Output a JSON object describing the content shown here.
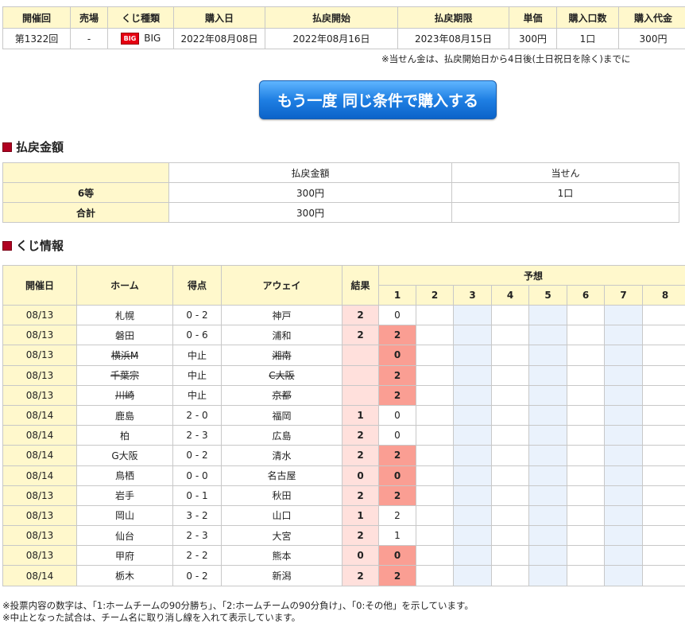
{
  "purchase": {
    "headers": [
      "開催回",
      "売場",
      "くじ種類",
      "購入日",
      "払戻開始",
      "払戻期限",
      "単価",
      "購入口数",
      "購入代金"
    ],
    "row": {
      "round": "第1322回",
      "shop": "-",
      "logo_text": "BIG",
      "kind": "BIG",
      "purchase_date": "2022年08月08日",
      "refund_start": "2022年08月16日",
      "refund_deadline": "2023年08月15日",
      "price": "300円",
      "units": "1口",
      "amount": "300円"
    }
  },
  "top_note": "※当せん金は、払戻開始日から4日後(土日祝日を除く)までに",
  "rebuy_button": "もう一度 同じ条件で購入する",
  "payout_section": {
    "title": "払戻金額",
    "headers": [
      "払戻金額",
      "当せん"
    ],
    "rows": [
      {
        "label": "6等",
        "amount": "300円",
        "count": "1口"
      },
      {
        "label": "合計",
        "amount": "300円",
        "count": ""
      }
    ]
  },
  "info_section": {
    "title": "くじ情報",
    "headers": {
      "date": "開催日",
      "home": "ホーム",
      "score": "得点",
      "away": "アウェイ",
      "result": "結果",
      "prediction": "予想",
      "cols": [
        "1",
        "2",
        "3",
        "4",
        "5",
        "6",
        "7",
        "8"
      ]
    },
    "rows": [
      {
        "date": "08/13",
        "home": "札幌",
        "score": "0 - 2",
        "away": "神戸",
        "result": "2",
        "pred": "0",
        "hit": false,
        "cancelled": false
      },
      {
        "date": "08/13",
        "home": "磐田",
        "score": "0 - 6",
        "away": "浦和",
        "result": "2",
        "pred": "2",
        "hit": true,
        "cancelled": false
      },
      {
        "date": "08/13",
        "home": "横浜M",
        "score": "中止",
        "away": "湘南",
        "result": "",
        "pred": "0",
        "hit": true,
        "cancelled": true
      },
      {
        "date": "08/13",
        "home": "千葉宗",
        "score": "中止",
        "away": "C大阪",
        "result": "",
        "pred": "2",
        "hit": true,
        "cancelled": true
      },
      {
        "date": "08/13",
        "home": "川崎",
        "score": "中止",
        "away": "京都",
        "result": "",
        "pred": "2",
        "hit": true,
        "cancelled": true
      },
      {
        "date": "08/14",
        "home": "鹿島",
        "score": "2 - 0",
        "away": "福岡",
        "result": "1",
        "pred": "0",
        "hit": false,
        "cancelled": false
      },
      {
        "date": "08/14",
        "home": "柏",
        "score": "2 - 3",
        "away": "広島",
        "result": "2",
        "pred": "0",
        "hit": false,
        "cancelled": false
      },
      {
        "date": "08/14",
        "home": "G大阪",
        "score": "0 - 2",
        "away": "清水",
        "result": "2",
        "pred": "2",
        "hit": true,
        "cancelled": false
      },
      {
        "date": "08/14",
        "home": "鳥栖",
        "score": "0 - 0",
        "away": "名古屋",
        "result": "0",
        "pred": "0",
        "hit": true,
        "cancelled": false
      },
      {
        "date": "08/13",
        "home": "岩手",
        "score": "0 - 1",
        "away": "秋田",
        "result": "2",
        "pred": "2",
        "hit": true,
        "cancelled": false
      },
      {
        "date": "08/13",
        "home": "岡山",
        "score": "3 - 2",
        "away": "山口",
        "result": "1",
        "pred": "2",
        "hit": false,
        "cancelled": false
      },
      {
        "date": "08/13",
        "home": "仙台",
        "score": "2 - 3",
        "away": "大宮",
        "result": "2",
        "pred": "1",
        "hit": false,
        "cancelled": false
      },
      {
        "date": "08/13",
        "home": "甲府",
        "score": "2 - 2",
        "away": "熊本",
        "result": "0",
        "pred": "0",
        "hit": true,
        "cancelled": false
      },
      {
        "date": "08/14",
        "home": "栃木",
        "score": "0 - 2",
        "away": "新潟",
        "result": "2",
        "pred": "2",
        "hit": true,
        "cancelled": false
      }
    ]
  },
  "notes": [
    "※投票内容の数字は、「1:ホームチームの90分勝ち」、「2:ホームチームの90分負け」、「0:その他」を示しています。",
    "※中止となった試合は、チーム名に取り消し線を入れて表示しています。"
  ],
  "colors": {
    "header_bg": "#fff8cc",
    "hit": "#fa9e93",
    "result_bg": "#ffe0dc",
    "alt_col": "#eaf2fc",
    "button": "#1f7fe3",
    "section_mark": "#b00020"
  }
}
